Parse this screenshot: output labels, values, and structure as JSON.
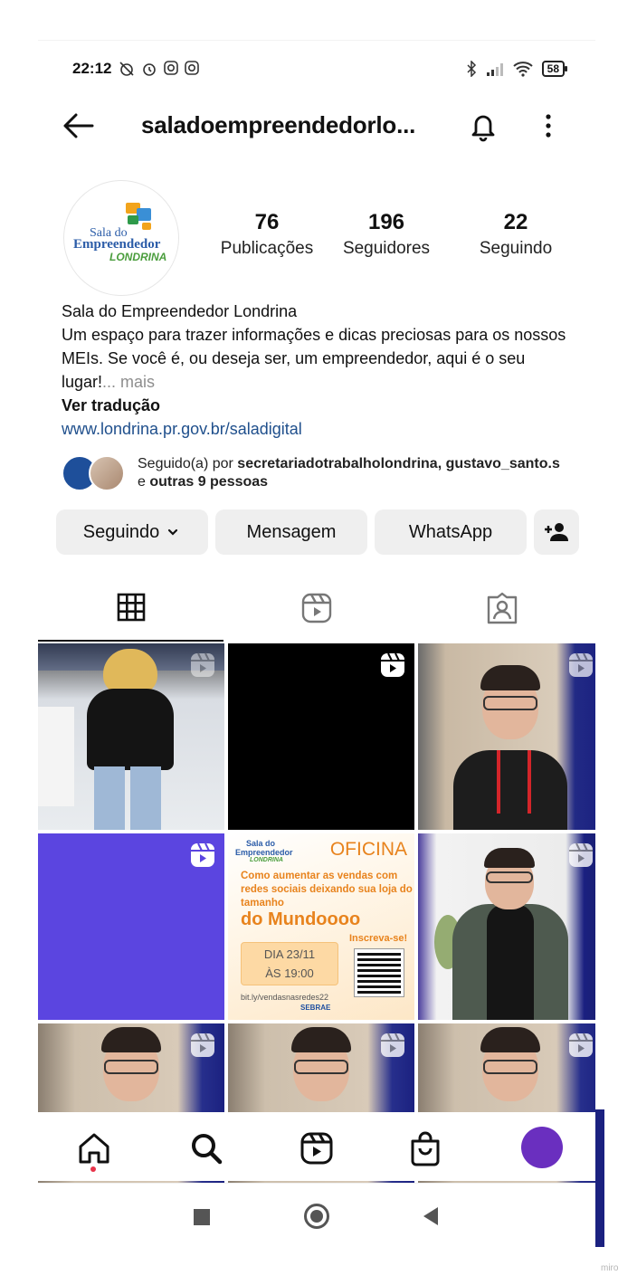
{
  "status_bar": {
    "time": "22:12",
    "battery": "58",
    "left_icons": [
      "alarm-off-icon",
      "alarm-icon",
      "instagram-icon",
      "instagram-icon"
    ],
    "right_icons": [
      "bluetooth-icon",
      "signal-icon",
      "wifi-icon",
      "battery-icon"
    ]
  },
  "header": {
    "username": "saladoempreendedorlo..."
  },
  "profile": {
    "avatar_lines": [
      "Sala do",
      "Empreendedor",
      "LONDRINA"
    ],
    "stats": [
      {
        "value": "76",
        "label": "Publicações"
      },
      {
        "value": "196",
        "label": "Seguidores"
      },
      {
        "value": "22",
        "label": "Seguindo"
      }
    ],
    "name": "Sala do Empreendedor Londrina",
    "bio": "Um espaço para trazer informações e dicas preciosas para os nossos MEIs. Se você é, ou deseja ser, um empreendedor, aqui é o seu lugar!",
    "bio_more": "... mais",
    "translate": "Ver tradução",
    "link": "www.londrina.pr.gov.br/saladigital",
    "followed_prefix": "Seguido(a) por ",
    "followed_names": "secretariadotrabalholondrina, gustavo_santo.s",
    "followed_and": "e ",
    "followed_others": "outras 9 pessoas"
  },
  "buttons": {
    "following": "Seguindo",
    "message": "Mensagem",
    "whatsapp": "WhatsApp"
  },
  "tabs": [
    "grid-icon",
    "reels-icon",
    "tagged-icon"
  ],
  "poster": {
    "logo_line1": "Sala do",
    "logo_line2": "Empreendedor",
    "logo_line3": "LONDRINA",
    "title": "OFICINA",
    "subtitle": "Como aumentar as vendas com redes sociais deixando sua loja do tamanho",
    "headline": "do Mundoooo",
    "date_line1": "DIA 23/11",
    "date_line2": "ÀS 19:00",
    "cta": "Inscreva-se!",
    "url": "bit.ly/vendasnasredes22",
    "sponsor": "SEBRAE"
  },
  "bottom_nav": [
    "home-icon",
    "search-icon",
    "reels-icon",
    "shop-icon",
    "profile-avatar"
  ],
  "watermark": "miro",
  "colors": {
    "link": "#1f4f8c",
    "button_bg": "#efefef",
    "profile_avatar": "#6a2fbf",
    "notification_dot": "#e8334a",
    "poster_orange": "#e8831d"
  }
}
